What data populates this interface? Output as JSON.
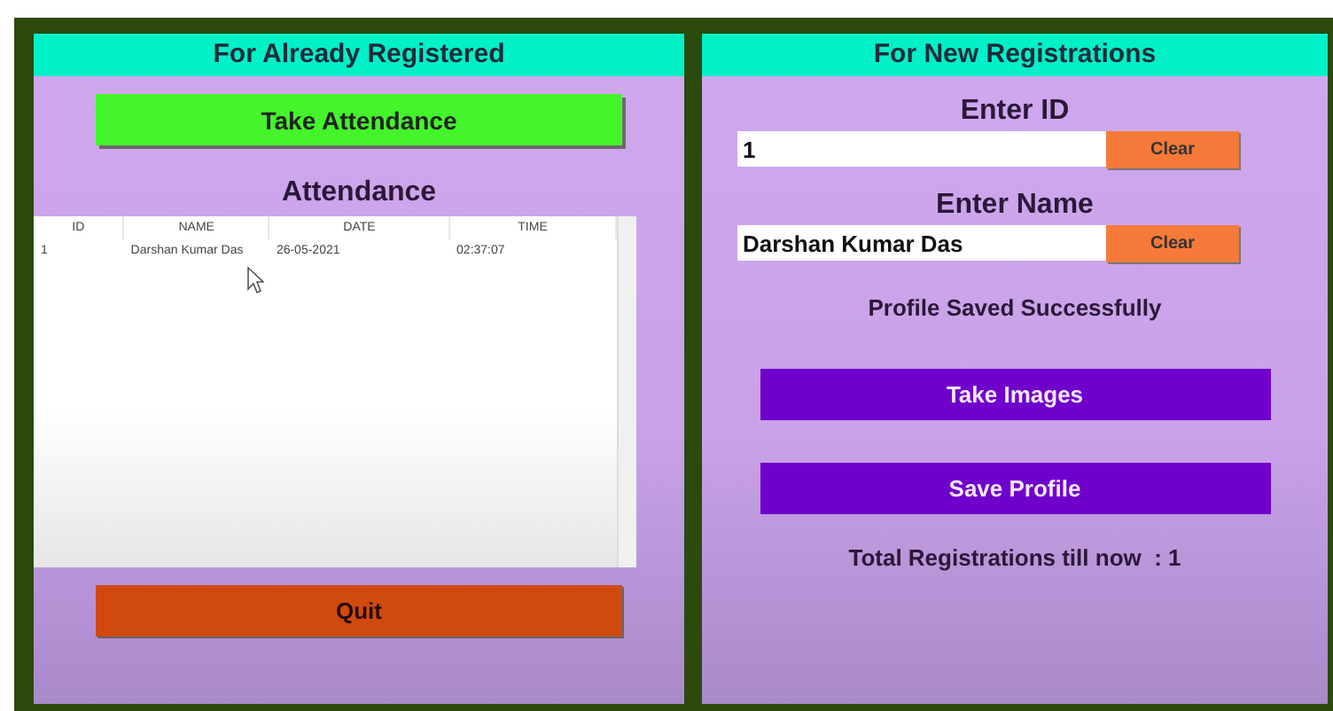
{
  "left_panel": {
    "title": "For Already Registered",
    "take_attendance_button": "Take Attendance",
    "attendance_title": "Attendance",
    "table": {
      "columns": [
        "ID",
        "NAME",
        "DATE",
        "TIME"
      ],
      "rows": [
        [
          "1",
          "Darshan Kumar Das",
          "26-05-2021",
          "02:37:07"
        ]
      ]
    },
    "quit_button": "Quit"
  },
  "right_panel": {
    "title": "For New Registrations",
    "fields": [
      {
        "label": "Enter ID",
        "value": "1",
        "clear_button": "Clear"
      },
      {
        "label": "Enter Name",
        "value": "Darshan Kumar Das",
        "clear_button": "Clear"
      }
    ],
    "message": "Profile Saved Successfully",
    "buttons": [
      "Take Images",
      "Save Profile"
    ],
    "total": "Total Registrations till now  : 1"
  }
}
